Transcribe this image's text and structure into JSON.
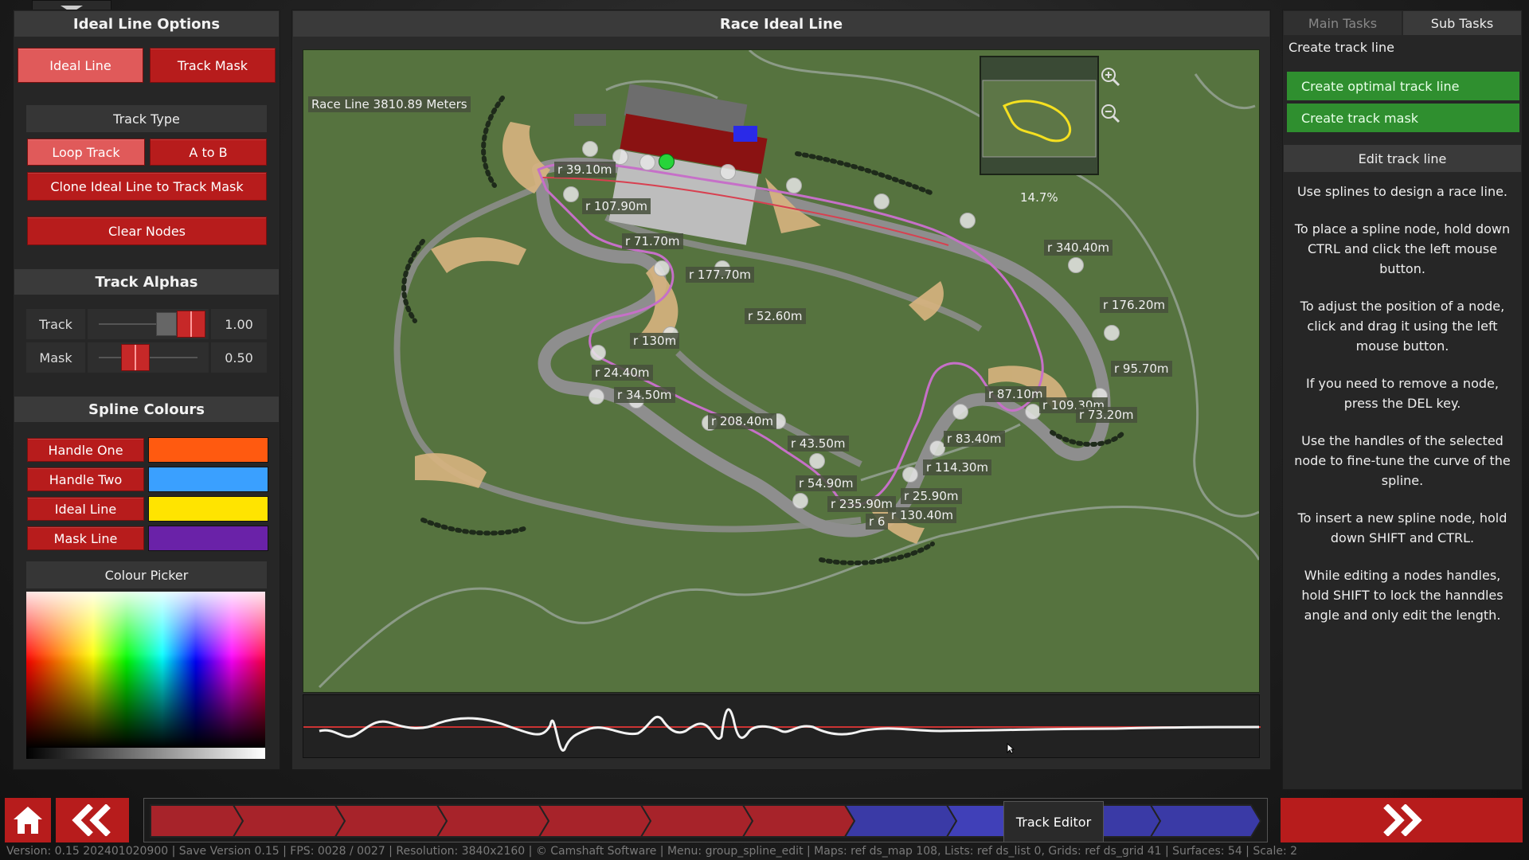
{
  "left": {
    "options_title": "Ideal Line Options",
    "tab_ideal": "Ideal Line",
    "tab_mask": "Track Mask",
    "track_type_label": "Track Type",
    "loop_track": "Loop Track",
    "a_to_b": "A to B",
    "clone_btn": "Clone Ideal Line to Track Mask",
    "clear_btn": "Clear Nodes",
    "alphas_title": "Track Alphas",
    "track_label": "Track",
    "track_value": "1.00",
    "mask_label": "Mask",
    "mask_value": "0.50",
    "spline_title": "Spline Colours",
    "spline_rows": [
      {
        "label": "Handle One",
        "color": "#ff5a10"
      },
      {
        "label": "Handle Two",
        "color": "#3aa0ff"
      },
      {
        "label": "Ideal Line",
        "color": "#ffe400"
      },
      {
        "label": "Mask Line",
        "color": "#6a22a8"
      }
    ],
    "colour_picker": "Colour Picker"
  },
  "center": {
    "title": "Race Ideal Line",
    "race_line": "Race Line 3810.89 Meters",
    "zoom": "14.7%",
    "radius_labels": [
      "r 39.10m",
      "r 107.90m",
      "r 71.70m",
      "r 177.70m",
      "r 52.60m",
      "r 130m",
      "r 24.40m",
      "r 34.50m",
      "r 208.40m",
      "r 43.50m",
      "r 54.90m",
      "r 235.90m",
      "r 6",
      "r 130.40m",
      "r 25.90m",
      "r 114.30m",
      "r 83.40m",
      "r 87.10m",
      "r 109.30m",
      "r 73.20m",
      "r 95.70m",
      "r 176.20m",
      "r 340.40m"
    ]
  },
  "right": {
    "tab_main": "Main Tasks",
    "tab_sub": "Sub Tasks",
    "create_track_line": "Create track line",
    "task_optimal": "Create optimal track line",
    "task_mask": "Create track mask",
    "edit_title": "Edit track line",
    "instructions": [
      "Use splines to design a race line.",
      "To place a spline node, hold down CTRL and click the left mouse button.",
      "To adjust the position of a node, click and drag it using the left mouse button.",
      "If you need to remove a node, press the DEL key.",
      "Use the handles of the selected node to fine-tune the curve of the spline.",
      "To insert a new spline node, hold down SHIFT and CTRL.",
      "While editing a nodes handles, hold SHIFT to lock the hanndles angle and only edit the length."
    ]
  },
  "bottom": {
    "track_editor": "Track Editor",
    "status": "Version: 0.15 202401020900  | Save Version 0.15  | FPS: 0028 / 0027  | Resolution: 3840x2160  | © Camshaft Software  | Menu: group_spline_edit  | Maps: ref ds_map 108, Lists: ref ds_list 0, Grids: ref ds_grid 41  | Surfaces: 54  | Scale: 2"
  }
}
